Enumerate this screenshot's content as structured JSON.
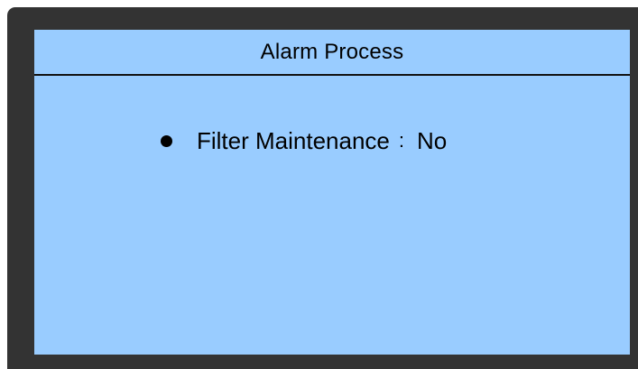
{
  "screen": {
    "title": "Alarm Process",
    "items": [
      {
        "label": "Filter Maintenance",
        "separator": ":",
        "value": "No"
      }
    ]
  },
  "colors": {
    "frame": "#333333",
    "screen_background": "#99ccff",
    "text": "#000000"
  },
  "icons": {
    "bullet": "bullet-dot-icon"
  }
}
